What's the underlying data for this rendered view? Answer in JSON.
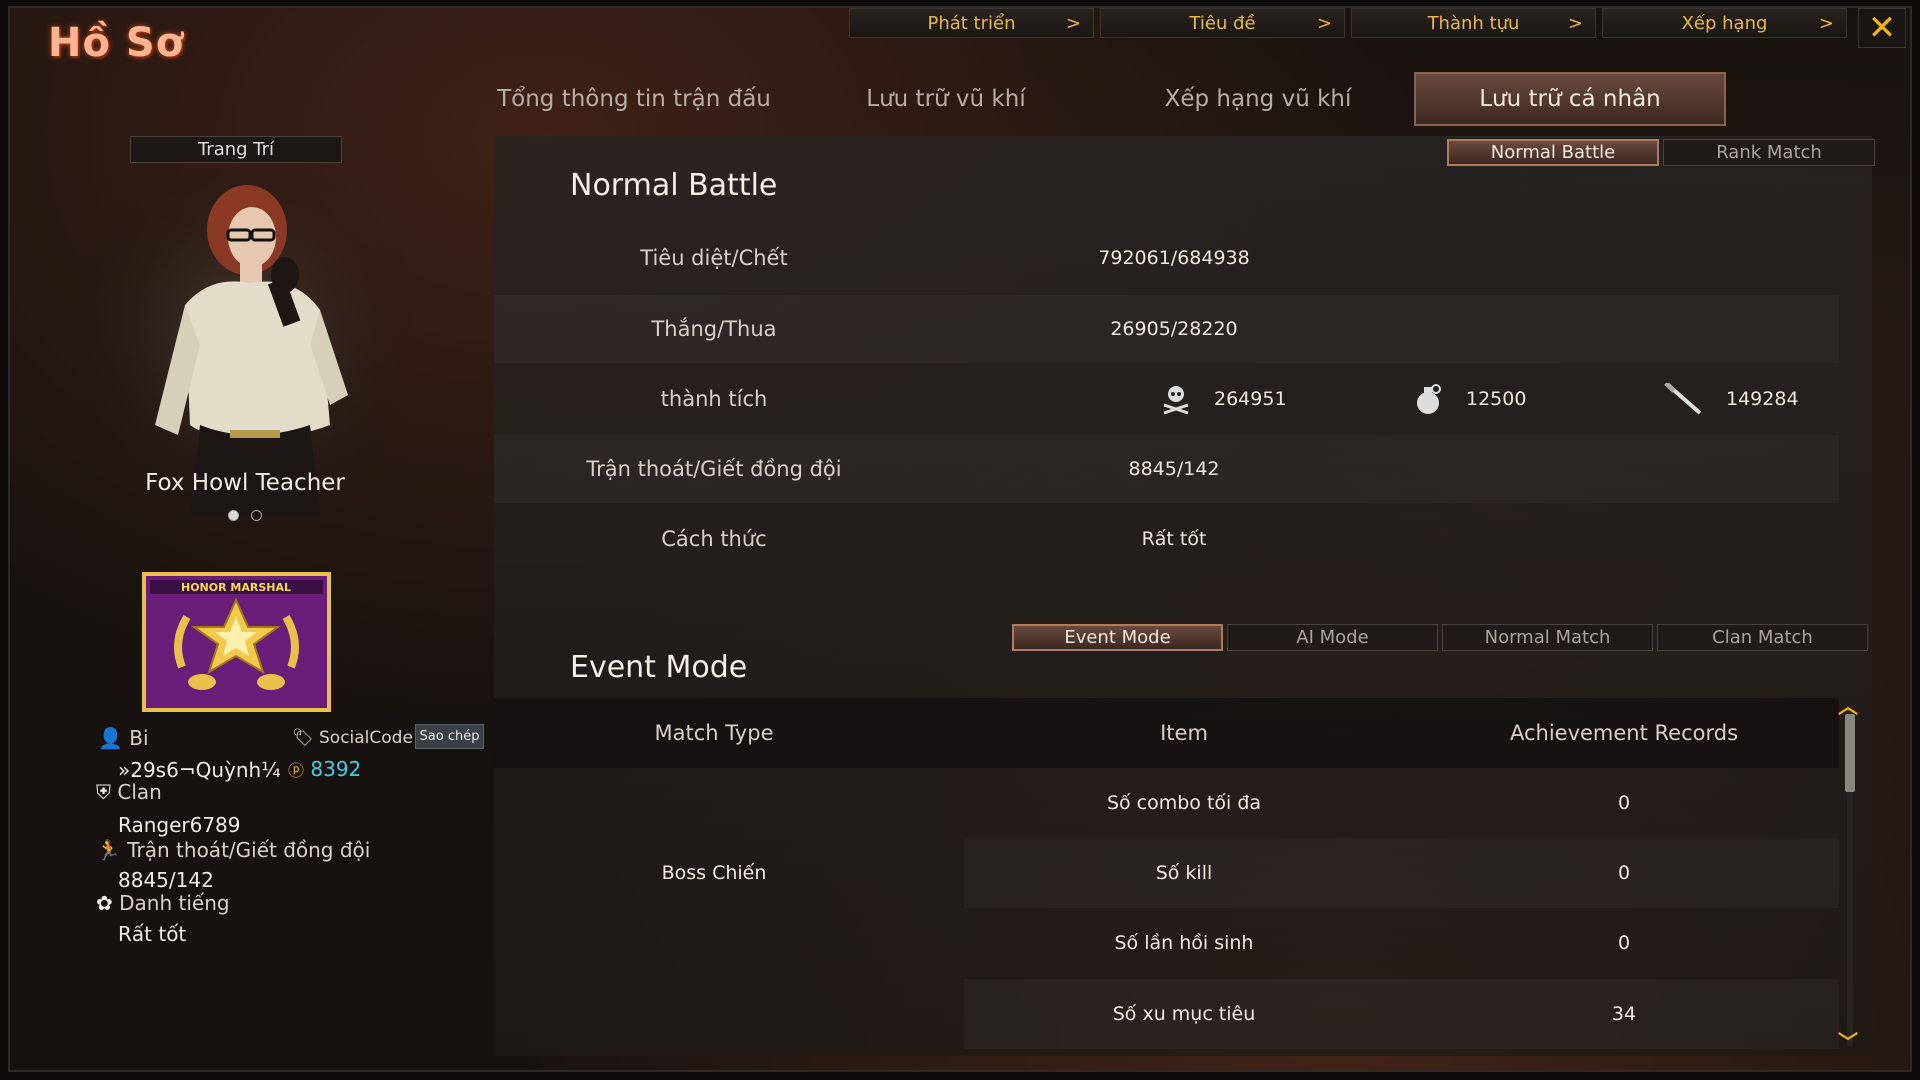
{
  "title": "Hồ Sơ",
  "top_nav": [
    {
      "label": "Phát triển",
      "chevron": ">"
    },
    {
      "label": "Tiêu đề",
      "chevron": ">"
    },
    {
      "label": "Thành tựu",
      "chevron": ">"
    },
    {
      "label": "Xếp hạng",
      "chevron": ">"
    }
  ],
  "close_label": "✕",
  "tabs": [
    {
      "label": "Tổng thông tin trận đấu"
    },
    {
      "label": "Lưu trữ vũ khí"
    },
    {
      "label": "Xếp hạng vũ khí"
    },
    {
      "label": "Lưu trữ cá nhân",
      "active": true
    }
  ],
  "left": {
    "decoration_label": "Trang Trí",
    "character_name": "Fox Howl Teacher",
    "badge_text": "HONOR MARSHAL",
    "player_label": "Bi",
    "player_name": "»29s6¬Quỳnh¼",
    "social_code_label": "SocialCode",
    "social_code_value": "8392",
    "copy_button": "Sao chép",
    "clan_label": "Clan",
    "clan_value": "Ranger6789",
    "desert_label": "Trận thoát/Giết đồng đội",
    "desert_value": "8845/142",
    "reputation_label": "Danh tiếng",
    "reputation_value": "Rất tốt"
  },
  "normal_battle": {
    "title": "Normal Battle",
    "mode_tabs": [
      {
        "label": "Normal Battle",
        "active": true
      },
      {
        "label": "Rank Match"
      }
    ],
    "rows": [
      {
        "label": "Tiêu diệt/Chết",
        "value": "792061/684938"
      },
      {
        "label": "Thắng/Thua",
        "value": "26905/28220"
      },
      {
        "label": "thành tích",
        "values": [
          "264951",
          "12500",
          "149284"
        ]
      },
      {
        "label": "Trận thoát/Giết đồng đội",
        "value": "8845/142"
      },
      {
        "label": "Cách thức",
        "value": "Rất tốt"
      }
    ],
    "achievement_icons": [
      "skull-crossbones-icon",
      "grenade-icon",
      "knife-icon"
    ]
  },
  "event_mode": {
    "title": "Event Mode",
    "mode_tabs": [
      {
        "label": "Event Mode",
        "active": true
      },
      {
        "label": "AI Mode"
      },
      {
        "label": "Normal Match"
      },
      {
        "label": "Clan Match"
      }
    ],
    "columns": [
      "Match Type",
      "Item",
      "Achievement Records"
    ],
    "match_type": "Boss Chiến",
    "rows": [
      {
        "item": "Số combo tối đa",
        "record": "0"
      },
      {
        "item": "Số kill",
        "record": "0"
      },
      {
        "item": "Số lần hồi sinh",
        "record": "0"
      },
      {
        "item": "Số xu mục tiêu",
        "record": "34"
      }
    ]
  },
  "colors": {
    "accent": "#f2b50e",
    "title": "#ffb591",
    "social_code": "#3fd0e8"
  }
}
